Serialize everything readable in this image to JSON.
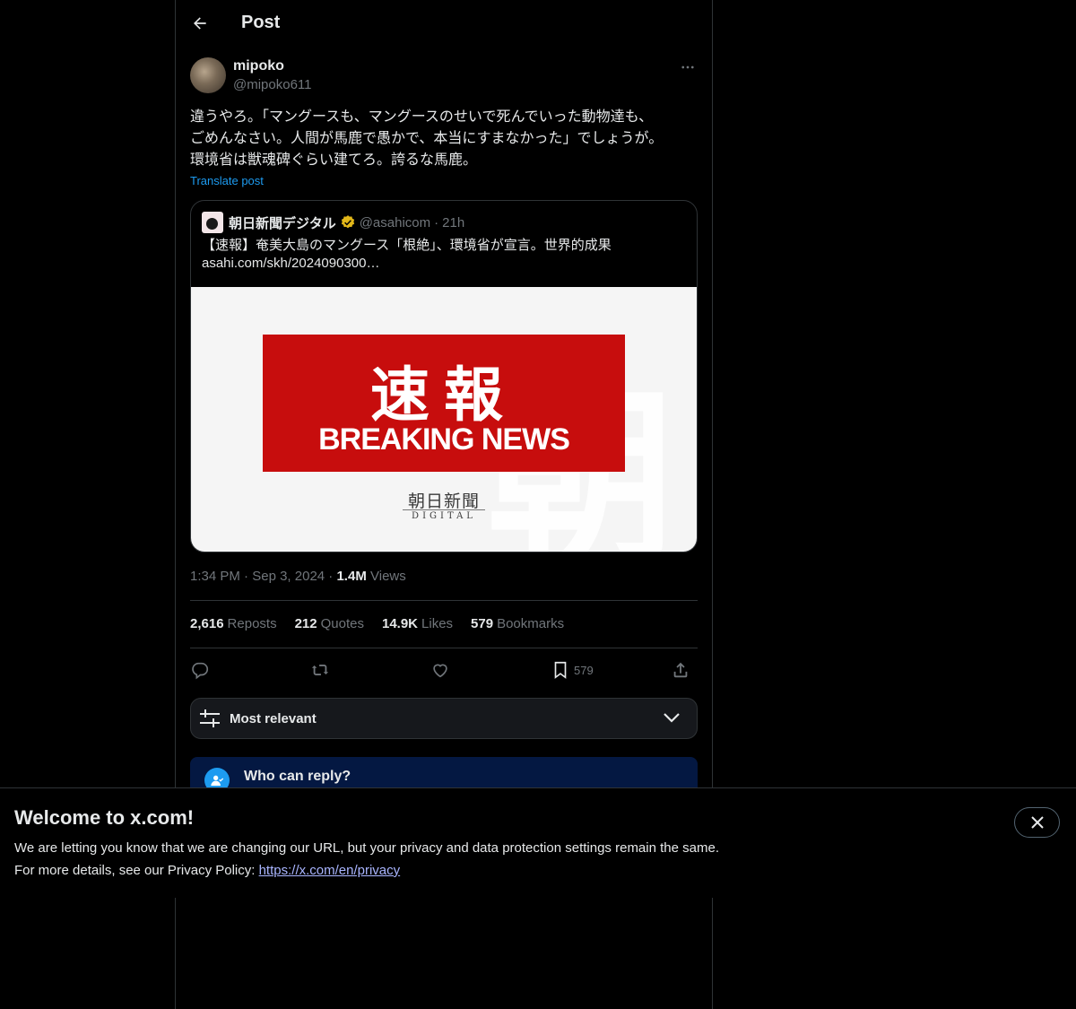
{
  "header": {
    "title": "Post"
  },
  "post": {
    "author_name": "mipoko",
    "author_handle": "@mipoko611",
    "text_lines": [
      "違うやろ。「マングースも、マングースのせいで死んでいった動物達も、",
      "ごめんなさい。人間が馬鹿で愚かで、本当にすまなかった」でしょうが。",
      "環境省は獣魂碑ぐらい建てろ。誇るな馬鹿。"
    ],
    "translate_label": "Translate post",
    "quote": {
      "name": "朝日新聞デジタル",
      "handle": "@asahicom",
      "separator": "·",
      "time": "21h",
      "text_line1": "【速報】奄美大島のマングース「根絶」、環境省が宣言。世界的成果",
      "text_line2": "asahi.com/skh/2024090300…",
      "media": {
        "headline_jp": "速報",
        "headline_en": "BREAKING NEWS",
        "brand_jp": "朝日新聞",
        "brand_en": "DIGITAL",
        "watermark": "朝"
      }
    },
    "timestamp_time": "1:34 PM",
    "separator": "·",
    "timestamp_date": "Sep 3, 2024",
    "views_count": "1.4M",
    "views_label": "Views",
    "stats": {
      "reposts_count": "2,616",
      "reposts_label": "Reposts",
      "quotes_count": "212",
      "quotes_label": "Quotes",
      "likes_count": "14.9K",
      "likes_label": "Likes",
      "bookmarks_count": "579",
      "bookmarks_label": "Bookmarks"
    },
    "actions": {
      "bookmark_count": "579"
    }
  },
  "sort": {
    "label": "Most relevant"
  },
  "reply_notice": {
    "title": "Who can reply?"
  },
  "banner": {
    "title": "Welcome to x.com!",
    "line1": "We are letting you know that we are changing our URL, but your privacy and data protection settings remain the same.",
    "line2_prefix": "For more details, see our Privacy Policy: ",
    "link_text": "https://x.com/en/privacy"
  },
  "colors": {
    "accent": "#1d9bf0",
    "background": "#000000",
    "muted": "#71767b",
    "verified_badge": "#e2b719"
  }
}
